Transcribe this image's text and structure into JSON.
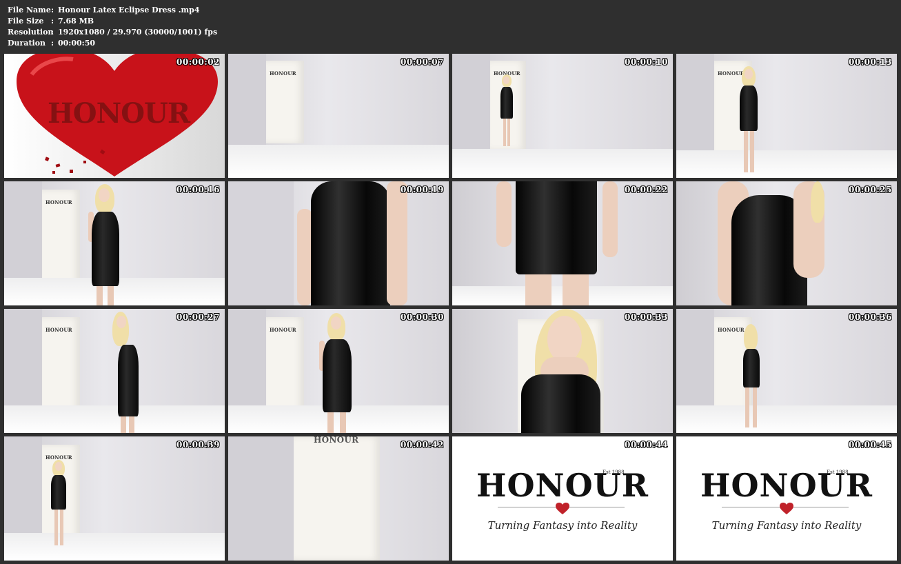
{
  "info": {
    "rows": [
      {
        "label": "File Name",
        "sep": ":",
        "value": "Honour Latex Eclipse Dress .mp4"
      },
      {
        "label": "File Size",
        "sep": ":",
        "value": "7.68 MB"
      },
      {
        "label": "Resolution",
        "sep": ":",
        "value": "1920x1080 / 29.970 (30000/1001) fps"
      },
      {
        "label": "Duration",
        "sep": ":",
        "value": "00:00:50"
      }
    ]
  },
  "thumbnails": [
    {
      "time": "00:00:02",
      "scene": "heart-logo",
      "overlay_text": "HONOUR"
    },
    {
      "time": "00:00:07",
      "scene": "empty-studio",
      "overlay_text": "HONOUR"
    },
    {
      "time": "00:00:10",
      "scene": "model-far"
    },
    {
      "time": "00:00:13",
      "scene": "model-walking"
    },
    {
      "time": "00:00:16",
      "scene": "model-pose"
    },
    {
      "time": "00:00:19",
      "scene": "dress-closeup-torso"
    },
    {
      "time": "00:00:22",
      "scene": "dress-closeup-skirt"
    },
    {
      "time": "00:00:25",
      "scene": "dress-closeup-bust"
    },
    {
      "time": "00:00:27",
      "scene": "model-side"
    },
    {
      "time": "00:00:30",
      "scene": "model-pose"
    },
    {
      "time": "00:00:33",
      "scene": "model-portrait"
    },
    {
      "time": "00:00:36",
      "scene": "model-back"
    },
    {
      "time": "00:00:39",
      "scene": "model-far"
    },
    {
      "time": "00:00:42",
      "scene": "empty-doorway",
      "overlay_text": "HONOUR"
    },
    {
      "time": "00:00:44",
      "scene": "brand-logo"
    },
    {
      "time": "00:00:45",
      "scene": "brand-logo"
    }
  ],
  "door_logo": "HONOUR",
  "brand": {
    "name": "HONOUR",
    "est": "Est 1988",
    "tagline": "Turning Fantasy into Reality"
  },
  "colors": {
    "background": "#2f2f2f",
    "heart": "#c8121a",
    "latex": "#0a0a0a",
    "brand_heart": "#c0222a"
  }
}
